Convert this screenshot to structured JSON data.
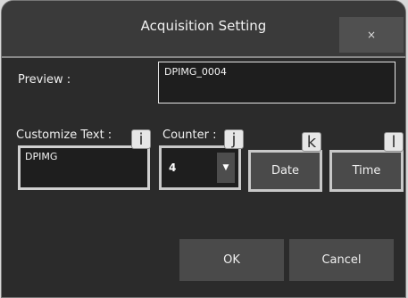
{
  "window": {
    "title": "Acquisition Setting",
    "close_label": "×"
  },
  "preview": {
    "label": "Preview :",
    "value": "DPIMG_0004"
  },
  "customize_text": {
    "label": "Customize Text :",
    "value": "DPIMG"
  },
  "counter": {
    "label": "Counter :",
    "value": "4",
    "dropdown_glyph": "▼"
  },
  "buttons": {
    "date": "Date",
    "time": "Time",
    "ok": "OK",
    "cancel": "Cancel"
  },
  "markers": {
    "i": "i",
    "j": "j",
    "k": "k",
    "l": "l"
  }
}
